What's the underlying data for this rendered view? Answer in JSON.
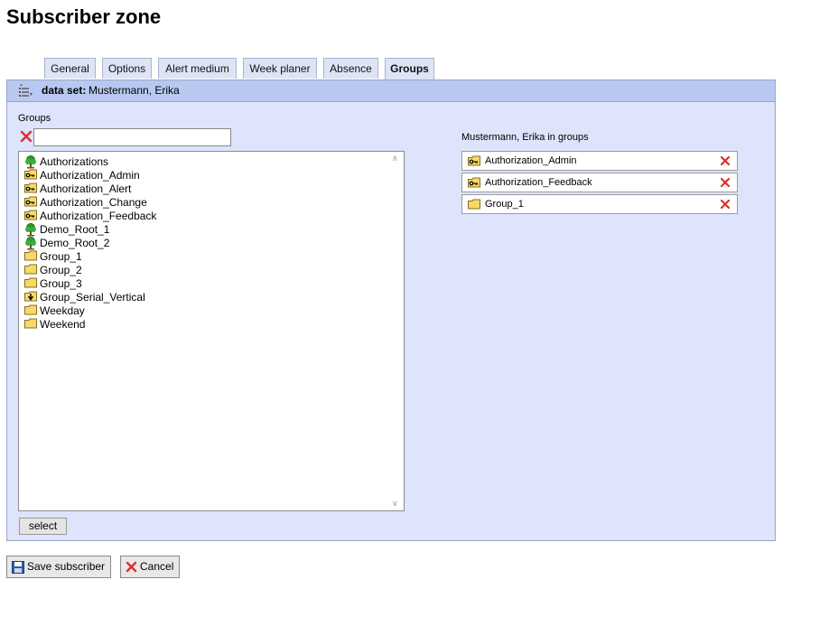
{
  "page": {
    "title": "Subscriber zone"
  },
  "tabs": [
    {
      "label": "General",
      "active": false
    },
    {
      "label": "Options",
      "active": false
    },
    {
      "label": "Alert medium",
      "active": false
    },
    {
      "label": "Week planer",
      "active": false
    },
    {
      "label": "Absence",
      "active": false
    },
    {
      "label": "Groups",
      "active": true
    }
  ],
  "header": {
    "label": "data set:",
    "value": "Mustermann, Erika",
    "icon": "dataset-icon"
  },
  "groups_section": {
    "label": "Groups",
    "filter_value": "",
    "items": [
      {
        "label": "Authorizations",
        "icon": "tree-icon"
      },
      {
        "label": "Authorization_Admin",
        "icon": "key-icon"
      },
      {
        "label": "Authorization_Alert",
        "icon": "key-icon"
      },
      {
        "label": "Authorization_Change",
        "icon": "key-icon"
      },
      {
        "label": "Authorization_Feedback",
        "icon": "key-icon"
      },
      {
        "label": "Demo_Root_1",
        "icon": "tree-icon"
      },
      {
        "label": "Demo_Root_2",
        "icon": "tree-icon"
      },
      {
        "label": "Group_1",
        "icon": "folder-icon"
      },
      {
        "label": "Group_2",
        "icon": "folder-icon"
      },
      {
        "label": "Group_3",
        "icon": "folder-icon"
      },
      {
        "label": "Group_Serial_Vertical",
        "icon": "serial-icon"
      },
      {
        "label": "Weekday",
        "icon": "folder-icon"
      },
      {
        "label": "Weekend",
        "icon": "folder-icon"
      }
    ],
    "select_button": "select"
  },
  "member_section": {
    "label": "Mustermann, Erika in groups",
    "items": [
      {
        "label": "Authorization_Admin",
        "icon": "key-icon"
      },
      {
        "label": "Authorization_Feedback",
        "icon": "key-icon"
      },
      {
        "label": "Group_1",
        "icon": "folder-icon"
      }
    ]
  },
  "footer": {
    "save_label": "Save subscriber",
    "cancel_label": "Cancel"
  },
  "colors": {
    "panel_bg": "#dde4fb",
    "header_bg": "#b8c8f0",
    "remove_red": "#d9302c",
    "folder_yellow": "#f7d96a"
  }
}
